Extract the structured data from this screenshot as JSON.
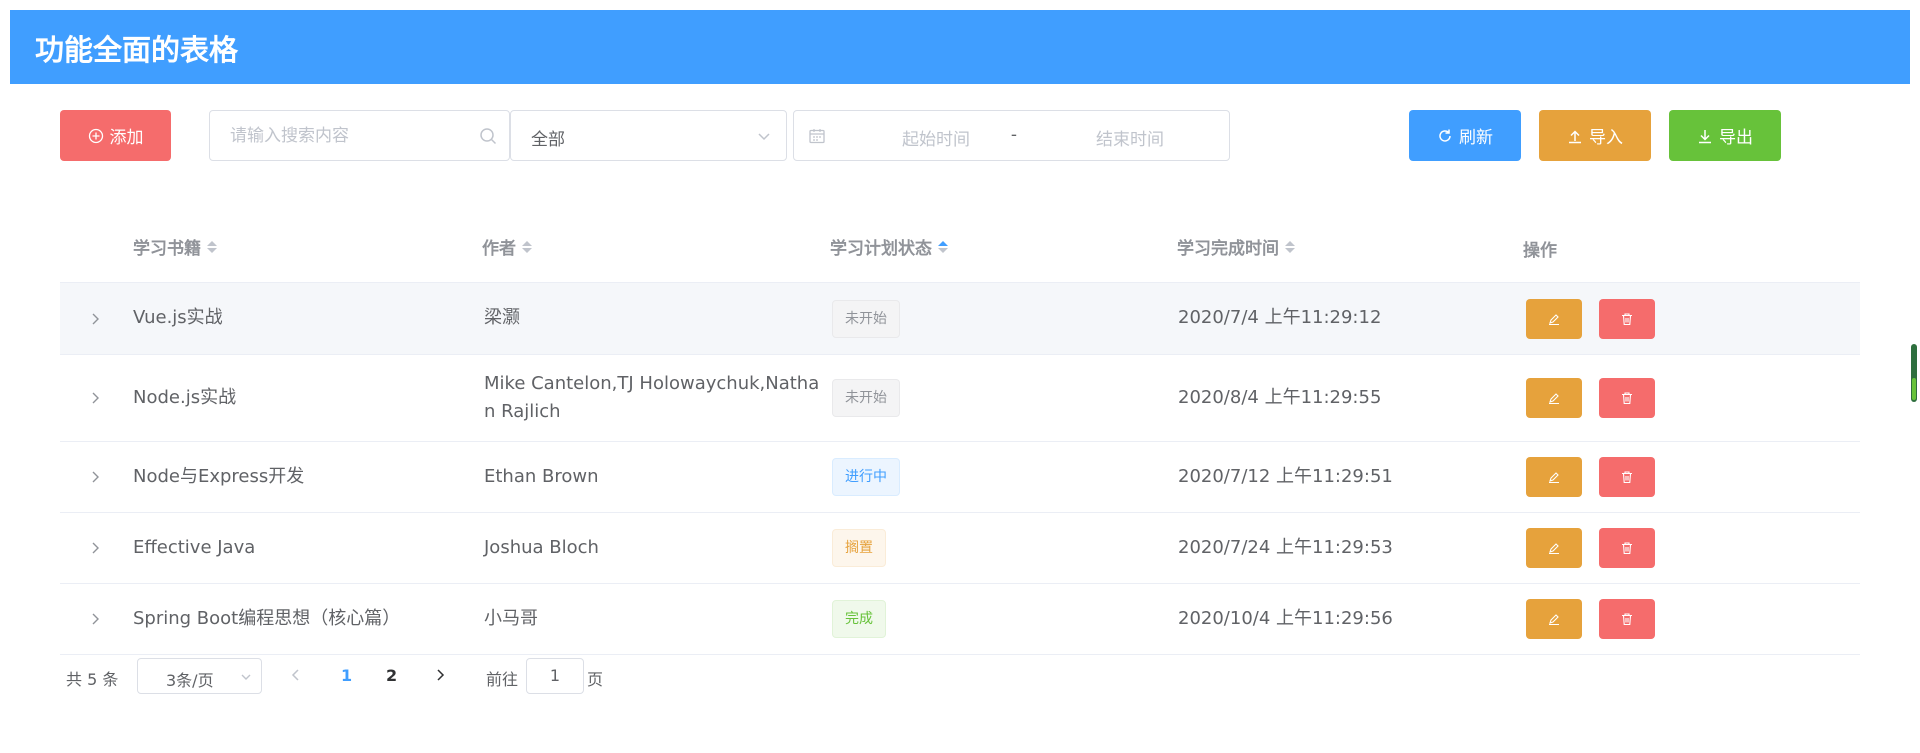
{
  "header": {
    "title": "功能全面的表格"
  },
  "toolbar": {
    "add_label": "添加",
    "search_placeholder": "请输入搜索内容",
    "select_value": "全部",
    "date_start_placeholder": "起始时间",
    "date_separator": "-",
    "date_end_placeholder": "结束时间",
    "refresh_label": "刷新",
    "import_label": "导入",
    "export_label": "导出"
  },
  "table": {
    "columns": [
      "学习书籍",
      "作者",
      "学习计划状态",
      "学习完成时间",
      "操作"
    ],
    "rows": [
      {
        "book": "Vue.js实战",
        "author": "梁灏",
        "status": "未开始",
        "status_type": "info",
        "time": "2020/7/4 上午11:29:12"
      },
      {
        "book": "Node.js实战",
        "author_line1": "Mike Cantelon,TJ Holowaychuk,Natha",
        "author_line2": "n Rajlich",
        "status": "未开始",
        "status_type": "info",
        "time": "2020/8/4 上午11:29:55"
      },
      {
        "book": "Node与Express开发",
        "author": "Ethan Brown",
        "status": "进行中",
        "status_type": "primary",
        "time": "2020/7/12 上午11:29:51"
      },
      {
        "book": "Effective Java",
        "author": "Joshua Bloch",
        "status": "搁置",
        "status_type": "warning",
        "time": "2020/7/24 上午11:29:53"
      },
      {
        "book": "Spring Boot编程思想（核心篇）",
        "author": "小马哥",
        "status": "完成",
        "status_type": "success",
        "time": "2020/10/4 上午11:29:56"
      }
    ]
  },
  "pagination": {
    "total": "共 5 条",
    "page_size": "3条/页",
    "pages": [
      "1",
      "2"
    ],
    "current_page": "1",
    "goto_label": "前往",
    "jump_value": "1",
    "page_word": "页"
  },
  "colors": {
    "header": "#409eff",
    "add": "#f56c6c",
    "refresh": "#409eff",
    "import": "#e6a23c",
    "export": "#67c23a"
  }
}
